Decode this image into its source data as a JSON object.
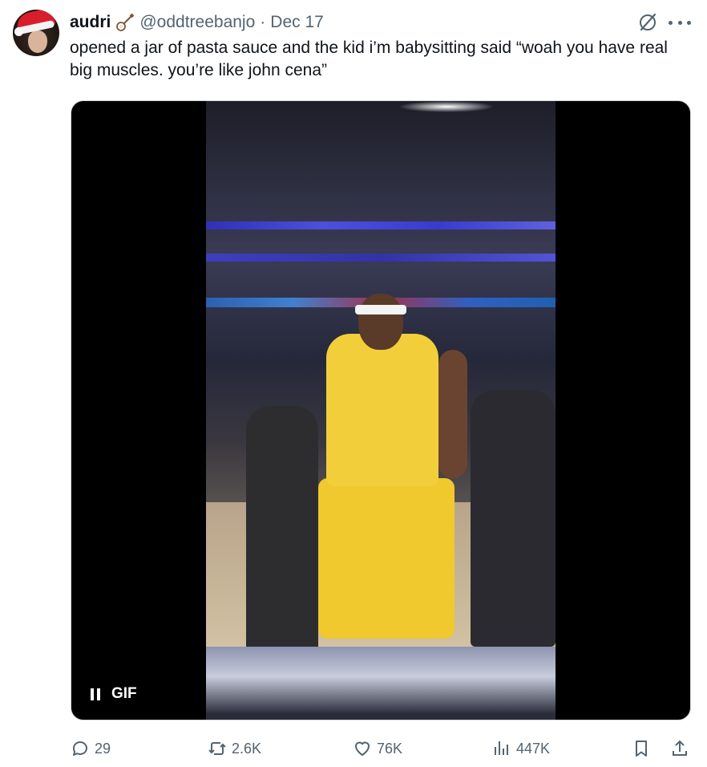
{
  "tweet": {
    "display_name": "audri",
    "handle": "@oddtreebanjo",
    "separator": "·",
    "date": "Dec 17",
    "text": "opened a jar of pasta sauce and the kid i’m babysitting said “woah you have real big muscles. you’re like john cena”"
  },
  "media": {
    "badge": "GIF",
    "playback_icon": "pause-icon"
  },
  "actions": {
    "replies": "29",
    "reposts": "2.6K",
    "likes": "76K",
    "views": "447K"
  },
  "icons": [
    "banjo-icon",
    "grok-icon",
    "more-icon",
    "reply-icon",
    "repost-icon",
    "like-icon",
    "views-icon",
    "bookmark-icon",
    "share-icon"
  ],
  "colors": {
    "text": "#0f1419",
    "secondary": "#536471",
    "border": "#cfd9de"
  }
}
